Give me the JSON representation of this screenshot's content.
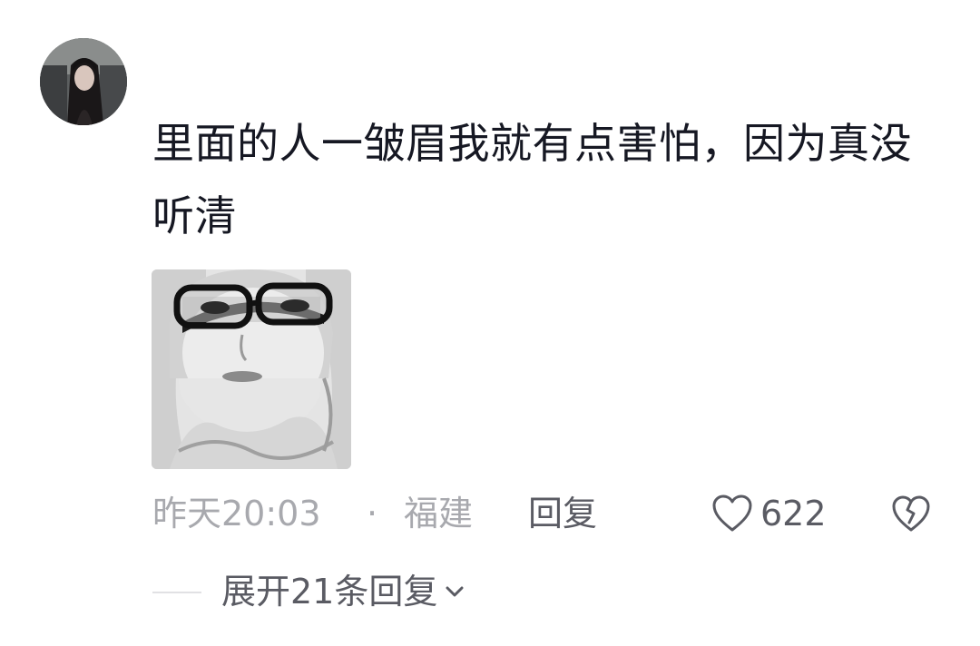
{
  "comment": {
    "avatar_icon": "user-avatar-photo",
    "text": "里面的人一皱眉我就有点害怕，因为真没听清",
    "sticker_icon": "meme-sticker-face-with-glasses",
    "time": "昨天20:03",
    "separator": "·",
    "location": "福建",
    "reply_label": "回复",
    "like_icon": "heart-outline-icon",
    "like_count": "622",
    "dislike_icon": "broken-heart-icon",
    "expand_label": "展开21条回复",
    "expand_icon": "chevron-down-icon"
  },
  "colors": {
    "primary_text": "#161823",
    "secondary_text": "#a8a9ae",
    "action_text": "#5a5b63",
    "divider": "#e1e1e4"
  }
}
